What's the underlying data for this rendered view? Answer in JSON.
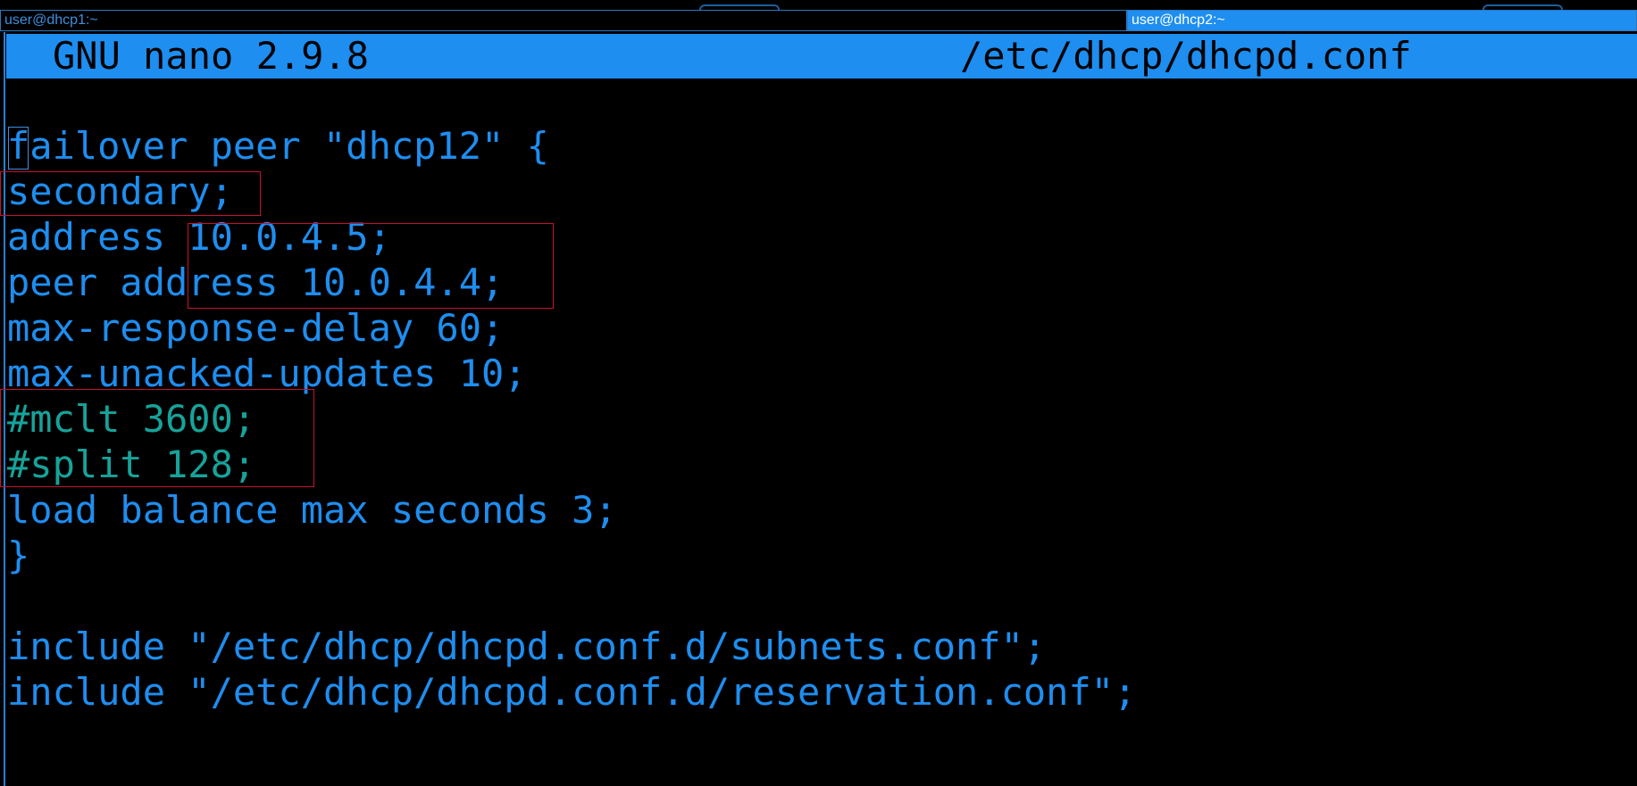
{
  "tabs": [
    {
      "label": "user@dhcp1:~",
      "active": false
    },
    {
      "label": "user@dhcp2:~",
      "active": true
    }
  ],
  "nano": {
    "app_title": "GNU nano 2.9.8",
    "file_path": "/etc/dhcp/dhcpd.conf"
  },
  "file_lines": [
    {
      "text": "failover peer \"dhcp12\" {",
      "kind": "code"
    },
    {
      "text": "secondary;",
      "kind": "code"
    },
    {
      "text": "address 10.0.4.5;",
      "kind": "code"
    },
    {
      "text": "peer address 10.0.4.4;",
      "kind": "code"
    },
    {
      "text": "max-response-delay 60;",
      "kind": "code"
    },
    {
      "text": "max-unacked-updates 10;",
      "kind": "code"
    },
    {
      "text": "#mclt 3600;",
      "kind": "comment"
    },
    {
      "text": "#split 128;",
      "kind": "comment"
    },
    {
      "text": "load balance max seconds 3;",
      "kind": "code"
    },
    {
      "text": "}",
      "kind": "code"
    },
    {
      "text": "",
      "kind": "blank"
    },
    {
      "text": "include \"/etc/dhcp/dhcpd.conf.d/subnets.conf\";",
      "kind": "code"
    },
    {
      "text": "include \"/etc/dhcp/dhcpd.conf.d/reservation.conf\";",
      "kind": "code"
    }
  ],
  "colors": {
    "background": "#000000",
    "text": "#1e8ef0",
    "comment": "#16a39a",
    "titlebar": "#1e8ef0",
    "highlight": "#c8102e"
  }
}
